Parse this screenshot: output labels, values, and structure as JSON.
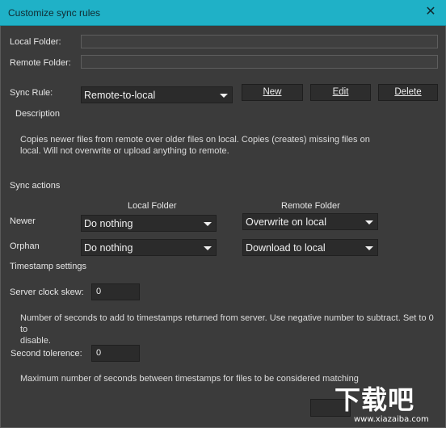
{
  "window": {
    "title": "Customize sync rules",
    "close_glyph": "✕"
  },
  "folders": {
    "local_label": "Local Folder:",
    "local_value": "",
    "remote_label": "Remote Folder:",
    "remote_value": ""
  },
  "rule": {
    "label": "Sync Rule:",
    "selected": "Remote-to-local",
    "new_label": "New",
    "edit_label": "Edit",
    "delete_label": "Delete",
    "description_heading": "Description",
    "description_text_1": "Copies newer files from remote over older files on local. Copies (creates) missing files on",
    "description_text_2": "local. Will not overwrite or upload anything to remote."
  },
  "actions": {
    "heading": "Sync actions",
    "col_local": "Local Folder",
    "col_remote": "Remote Folder",
    "rows": [
      {
        "label": "Newer",
        "local": "Do nothing",
        "remote": "Overwrite on local"
      },
      {
        "label": "Orphan",
        "local": "Do nothing",
        "remote": "Download to local"
      }
    ]
  },
  "timestamp": {
    "heading": "Timestamp settings",
    "skew_label": "Server clock skew:",
    "skew_value": "0",
    "skew_help_1": "Number of seconds to add to timestamps returned from server. Use negative number to subtract. Set to 0 to",
    "skew_help_2": "disable.",
    "tolerance_label": "Second tolerence:",
    "tolerance_value": "0",
    "tolerance_help": "Maximum number of seconds between timestamps for files to be considered matching"
  },
  "watermark": {
    "big": "下载吧",
    "url": "www.xiazaiba.com"
  },
  "icons": {
    "close": "close-icon",
    "dropdown": "chevron-down-icon"
  },
  "colors": {
    "titlebar": "#1fb1c7",
    "background": "#3b3b3b",
    "control": "#2b2b2b"
  }
}
